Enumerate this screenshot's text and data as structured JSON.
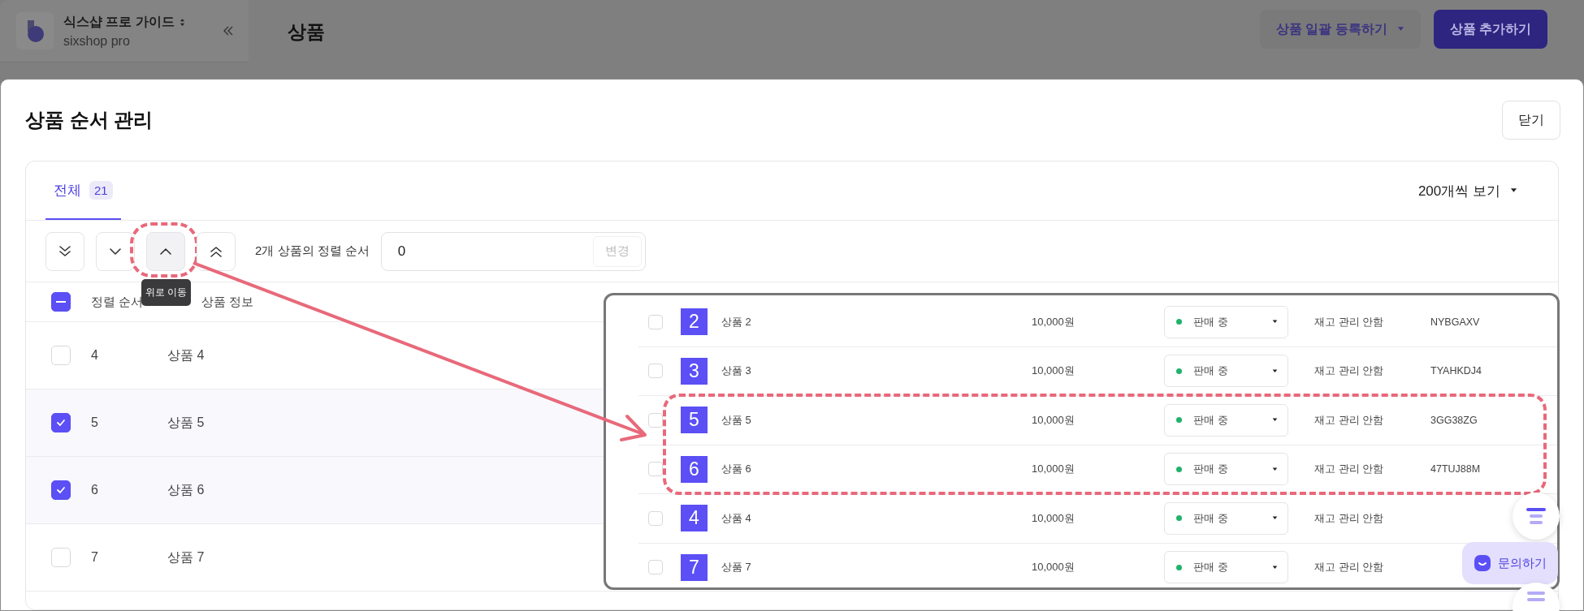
{
  "header": {
    "workspace": "식스샵 프로 가이드",
    "subtitle": "sixshop pro",
    "page_title": "상품",
    "buttons": [
      {
        "label": "상품 일괄 등록하기",
        "kind": "dropdown"
      },
      {
        "label": "상품 추가하기",
        "kind": "primary"
      }
    ]
  },
  "modal": {
    "title": "상품 순서 관리",
    "close_button": "닫기",
    "tabs": [
      {
        "label": "전체",
        "count": "21",
        "selected": true
      }
    ],
    "page_size": "200개씩 보기",
    "move_buttons": [
      {
        "kind": "bottom",
        "hovered": false
      },
      {
        "kind": "down",
        "hovered": false
      },
      {
        "kind": "up",
        "hovered": true
      },
      {
        "kind": "top",
        "hovered": false
      }
    ],
    "tooltip": "위로 이동",
    "order_label": "2개 상품의 정렬 순서",
    "order_value": "0",
    "apply_button": "변경",
    "select_all_indeterminate": true,
    "columns": [
      "정렬 순서",
      "상품 정보"
    ],
    "rows": [
      {
        "order": "4",
        "name": "상품 4",
        "selected": false
      },
      {
        "order": "5",
        "name": "상품 5",
        "selected": true
      },
      {
        "order": "6",
        "name": "상품 6",
        "selected": true
      },
      {
        "order": "7",
        "name": "상품 7",
        "selected": false
      }
    ]
  },
  "inset": {
    "rows": [
      {
        "checked": false,
        "number": "2",
        "name": "상품 2",
        "price": "10,000원",
        "status": "판매 중",
        "stock": "재고 관리 안함",
        "code": "NYBGAXV",
        "highlighted": false
      },
      {
        "checked": false,
        "number": "3",
        "name": "상품 3",
        "price": "10,000원",
        "status": "판매 중",
        "stock": "재고 관리 안함",
        "code": "TYAHKDJ4",
        "highlighted": false
      },
      {
        "checked": false,
        "number": "5",
        "name": "상품 5",
        "price": "10,000원",
        "status": "판매 중",
        "stock": "재고 관리 안함",
        "code": "3GG38ZG",
        "highlighted": true
      },
      {
        "checked": false,
        "number": "6",
        "name": "상품 6",
        "price": "10,000원",
        "status": "판매 중",
        "stock": "재고 관리 안함",
        "code": "47TUJ88M",
        "highlighted": true
      },
      {
        "checked": false,
        "number": "4",
        "name": "상품 4",
        "price": "10,000원",
        "status": "판매 중",
        "stock": "재고 관리 안함",
        "highlighted": false
      },
      {
        "checked": false,
        "number": "7",
        "name": "상품 7",
        "price": "10,000원",
        "status": "판매 중",
        "stock": "재고 관리 안함",
        "highlighted": false
      }
    ]
  },
  "floating": {
    "chat_button": "문의하기"
  }
}
